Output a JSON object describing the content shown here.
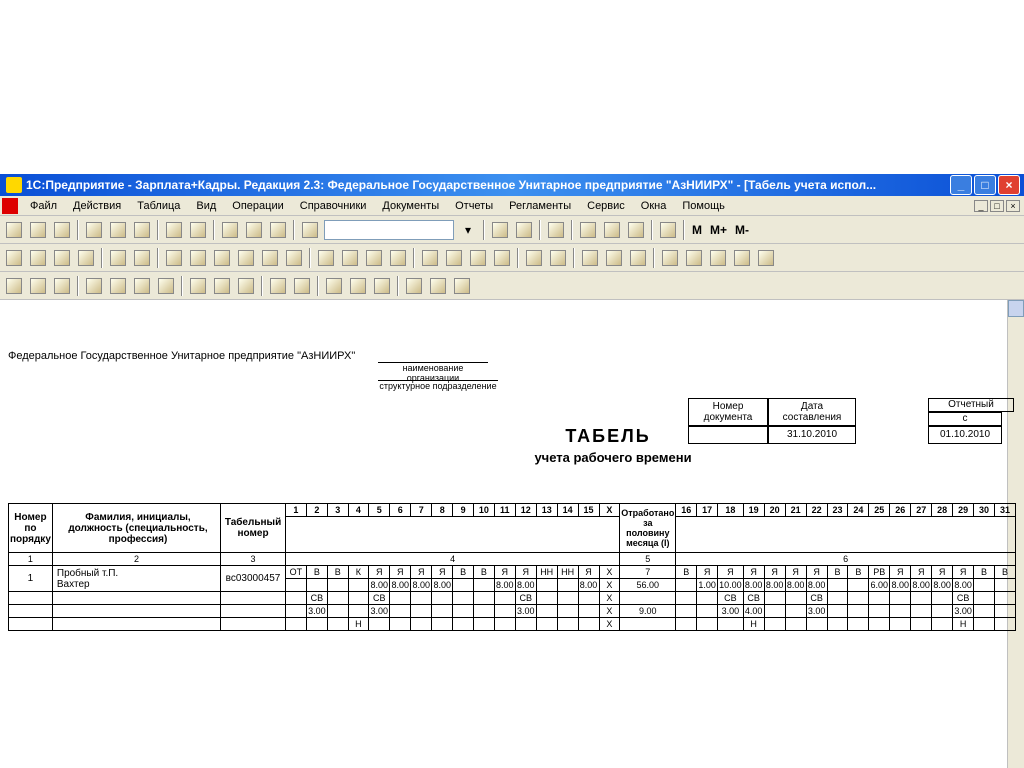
{
  "titlebar": {
    "text": "1С:Предприятие - Зарплата+Кадры. Редакция 2.3: Федеральное Государственное Унитарное предприятие \"АзНИИРХ\" - [Табель учета испол..."
  },
  "menu": [
    "Файл",
    "Действия",
    "Таблица",
    "Вид",
    "Операции",
    "Справочники",
    "Документы",
    "Отчеты",
    "Регламенты",
    "Сервис",
    "Окна",
    "Помощь"
  ],
  "mdi": {
    "min": "_",
    "max": "□",
    "close": "×"
  },
  "mbtns": {
    "m": "M",
    "mp": "M+",
    "mm": "M-"
  },
  "doc": {
    "org": "Федеральное Государственное Унитарное предприятие \"АзНИИРХ\"",
    "org_label": "наименование организации",
    "dept_label": "структурное подразделение",
    "title": "ТАБЕЛЬ",
    "subtitle": "учета  рабочего времени",
    "info": {
      "docnum_h": "Номер документа",
      "date_h": "Дата составления",
      "date_v": "31.10.2010",
      "period_h": "Отчетный",
      "period_from_h": "с",
      "period_from_v": "01.10.2010"
    }
  },
  "headers": {
    "rownum": "Номер по порядку",
    "name": "Фамилия, инициалы, должность (специальность, профессия)",
    "tabnum": "Табельный номер",
    "half": "Отработано за половину месяца (I)",
    "groups": {
      "c1": "1",
      "c2": "2",
      "c3": "3",
      "c4": "4",
      "c5": "5",
      "c6": "6"
    }
  },
  "days1": [
    "1",
    "2",
    "3",
    "4",
    "5",
    "6",
    "7",
    "8",
    "9",
    "10",
    "11",
    "12",
    "13",
    "14",
    "15",
    "X"
  ],
  "days2": [
    "16",
    "17",
    "18",
    "19",
    "20",
    "21",
    "22",
    "23",
    "24",
    "25",
    "26",
    "27",
    "28",
    "29",
    "30",
    "31"
  ],
  "rows": [
    {
      "num": "1",
      "name1": "Пробный т.П.",
      "name2": "Вахтер",
      "tabnum": "вс03000457",
      "r1": [
        "ОТ",
        "В",
        "В",
        "К",
        "Я",
        "Я",
        "Я",
        "Я",
        "В",
        "В",
        "Я",
        "Я",
        "НН",
        "НН",
        "Я",
        "X"
      ],
      "r1half": "7",
      "r1b": [
        "В",
        "Я",
        "Я",
        "Я",
        "Я",
        "Я",
        "Я",
        "В",
        "В",
        "РВ",
        "Я",
        "Я",
        "Я",
        "Я",
        "В",
        "В"
      ],
      "r2": [
        "",
        "",
        "",
        "",
        "8.00",
        "8.00",
        "8.00",
        "8.00",
        "",
        "",
        "8.00",
        "8.00",
        "",
        "",
        "8.00",
        "X"
      ],
      "r2half": "56.00",
      "r2b": [
        "",
        "1.00",
        "10.00",
        "8.00",
        "8.00",
        "8.00",
        "8.00",
        "",
        "",
        "6.00",
        "8.00",
        "8.00",
        "8.00",
        "8.00",
        "",
        ""
      ],
      "r3": [
        "",
        "СВ",
        "",
        "",
        "СВ",
        "",
        "",
        "",
        "",
        "",
        "",
        "СВ",
        "",
        "",
        "",
        "X"
      ],
      "r3half": "",
      "r3b": [
        "",
        "",
        "СВ",
        "СВ",
        "",
        "",
        "СВ",
        "",
        "",
        "",
        "",
        "",
        "",
        "СВ",
        "",
        ""
      ],
      "r4": [
        "",
        "3.00",
        "",
        "",
        "3.00",
        "",
        "",
        "",
        "",
        "",
        "",
        "3.00",
        "",
        "",
        "",
        "X"
      ],
      "r4half": "9.00",
      "r4b": [
        "",
        "",
        "3.00",
        "4.00",
        "",
        "",
        "3.00",
        "",
        "",
        "",
        "",
        "",
        "",
        "3.00",
        "",
        ""
      ],
      "r5": [
        "",
        "",
        "",
        "Н",
        "",
        "",
        "",
        "",
        "",
        "",
        "",
        "",
        "",
        "",
        "",
        "X"
      ],
      "r5half": "",
      "r5b": [
        "",
        "",
        "",
        "Н",
        "",
        "",
        "",
        "",
        "",
        "",
        "",
        "",
        "",
        "Н",
        "",
        ""
      ]
    }
  ]
}
